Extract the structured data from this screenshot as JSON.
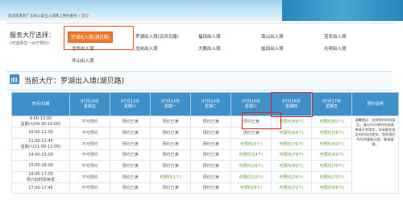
{
  "breadcrumb": {
    "prefix": "欢迎您来到广东省公安出入境网上预约服务 » ",
    "current": "首页"
  },
  "halls": {
    "label": "服务大厅选择：",
    "sublabel": "(可选择任一大厅预约)",
    "items": [
      "罗湖出入境(湖贝路)",
      "罗湖出入境(沿河北路)",
      "福田出入境",
      "南山出入境",
      "宝安出入境",
      "龙华出入境",
      "龙岗出入境",
      "大鹏出入境",
      "盐田出入境",
      "光明出入境",
      "坪山出入境"
    ]
  },
  "current_hall": {
    "label": "当前大厅：罗湖出入境(湖贝路)"
  },
  "table": {
    "corner": "时间/日期",
    "note_header": "预约说明",
    "columns": [
      {
        "date": "07月10日",
        "weekday": "星期五"
      },
      {
        "date": "07月11日",
        "weekday": "星期六"
      },
      {
        "date": "07月13日",
        "weekday": "星期一"
      },
      {
        "date": "07月14日",
        "weekday": "星期二"
      },
      {
        "date": "07月15日",
        "weekday": "星期三"
      },
      {
        "date": "07月16日",
        "weekday": "星期四"
      },
      {
        "date": "07月17日",
        "weekday": "星期五"
      }
    ],
    "rows": [
      {
        "time": "9:00-10:00",
        "time2": "星期六(09:30-10:00)",
        "cells": [
          "不可预约",
          "预约已满",
          "预约已满",
          "预约已满",
          "预约已满",
          "可预约(69个)",
          "可预约(61个)"
        ]
      },
      {
        "time": "10:00-11:00",
        "time2": "",
        "cells": [
          "不可预约",
          "预约已满",
          "预约已满",
          "预约已满",
          "预约已满",
          "可预约(64个)",
          "可预约(56个)"
        ]
      },
      {
        "time": "11:00-11:45",
        "time2": "星期六(11:00-12:00)",
        "cells": [
          "不可预约",
          "预约已满",
          "预约已满",
          "预约已满",
          "可预约(4个)",
          "可预约(76个)",
          "可预约(69个)"
        ]
      },
      {
        "time": "14:00-15:00",
        "time2": "",
        "cells": [
          "不可预约",
          "预约已满",
          "预约已满",
          "预约已满",
          "可预约(14个)",
          "可预约(79个)",
          "可预约(69个)"
        ]
      },
      {
        "time": "15:00-16:00",
        "time2": "",
        "cells": [
          "不可预约",
          "预约已满",
          "预约已满",
          "预约已满",
          "可预约(16个)",
          "可预约(80个)",
          "可预约(70个)"
        ]
      },
      {
        "time": "16:00-17:00",
        "time2": "周六此时段休息",
        "cells": [
          "不可预约",
          "预约已满",
          "可预约(1个)",
          "预约已满",
          "可预约(10个)",
          "可预约(78个)",
          "可预约(73个)"
        ]
      },
      {
        "time": "17:00-17:45",
        "time2": "",
        "cells": [
          "不可预约",
          "预约已满",
          "预约已满",
          "预约已满",
          "可预约(9个)",
          "可预约(71个)",
          "可预约(66个)"
        ]
      }
    ],
    "note": "温馨提示：选择预约时间段后，请在10分钟内完成表单填写并提交，如未能在规定的时间内提交，您所预约的号将重新分配，敬请留意。"
  },
  "colors": {
    "header_blue": "#3f8fc9",
    "available_bg": "#e7f4dc",
    "selected_orange": "#f07a2a",
    "highlight_red": "#dd2222"
  }
}
